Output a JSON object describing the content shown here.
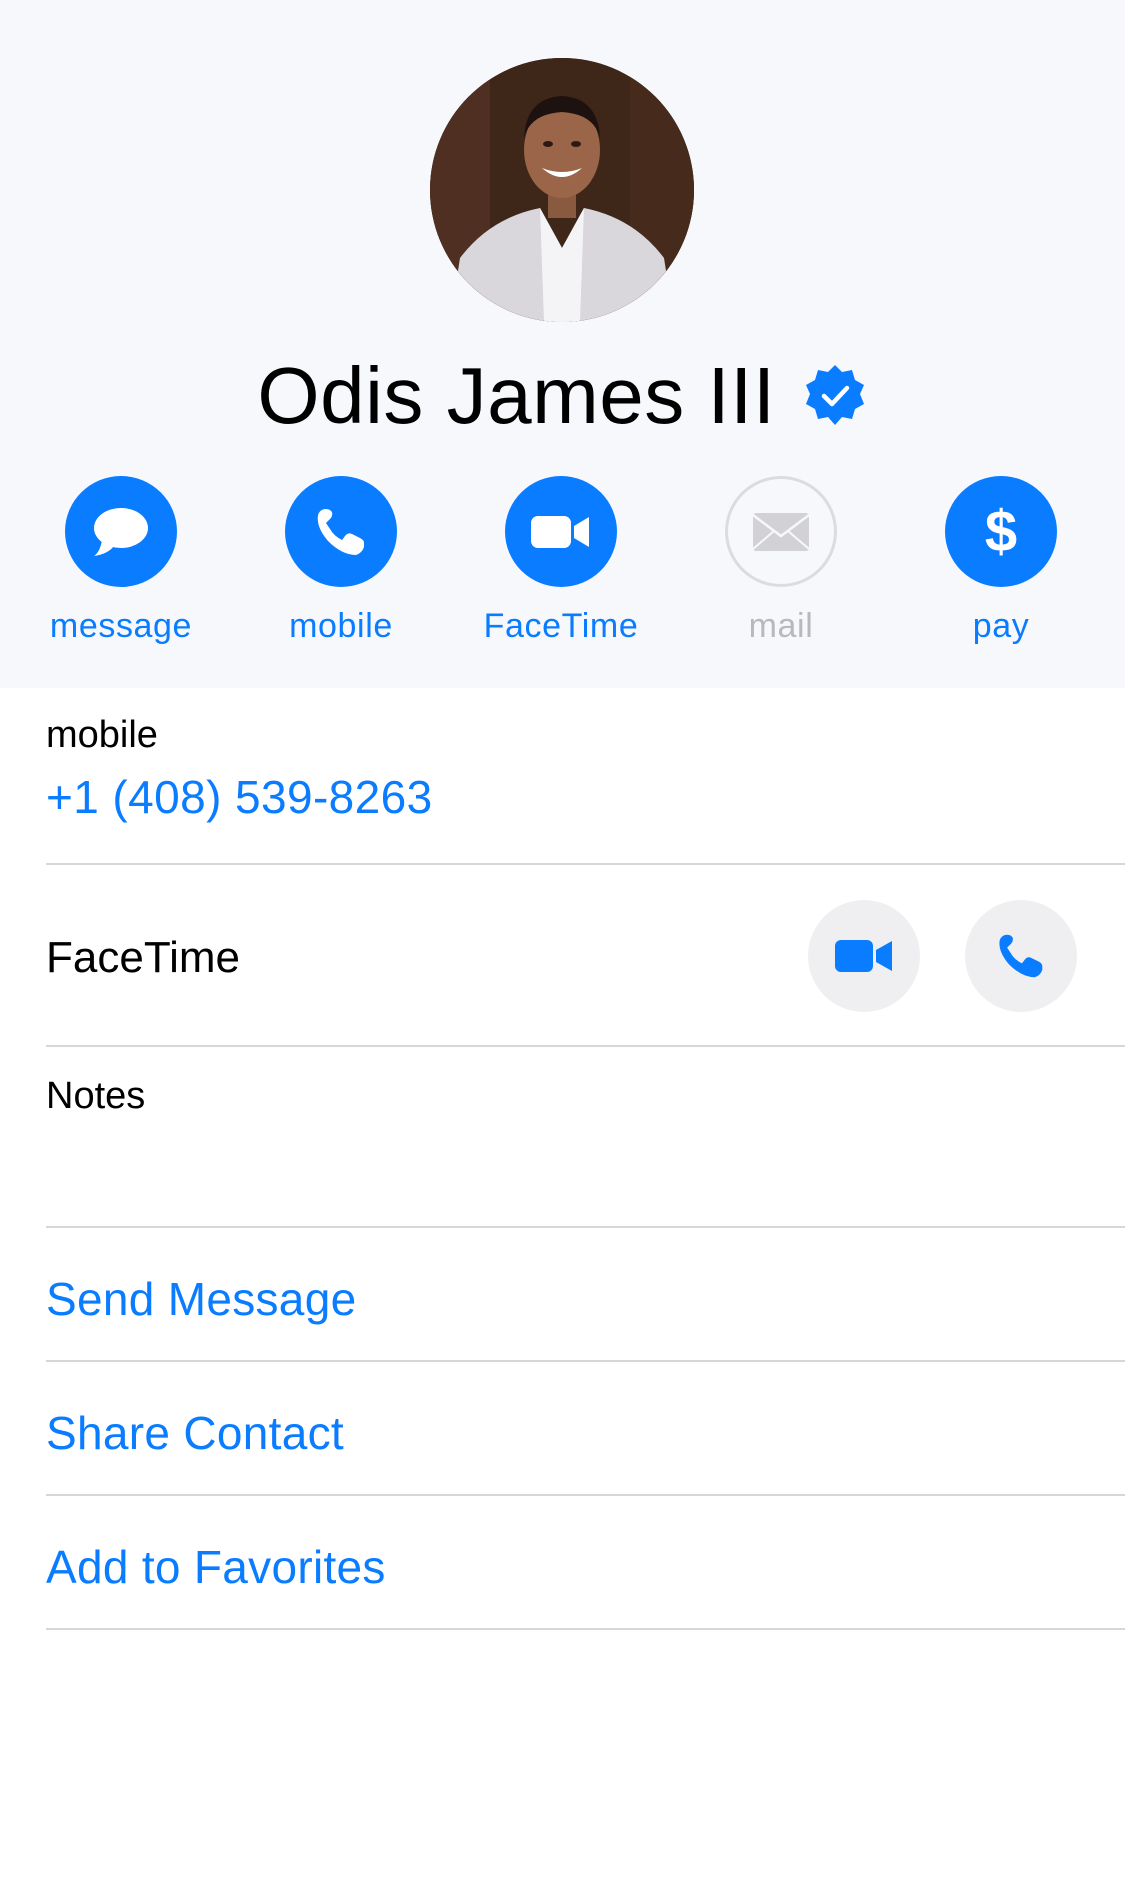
{
  "contact": {
    "name": "Odis James III",
    "verified": true
  },
  "actions": [
    {
      "label": "message",
      "icon": "message-bubble-icon",
      "enabled": true
    },
    {
      "label": "mobile",
      "icon": "phone-icon",
      "enabled": true
    },
    {
      "label": "FaceTime",
      "icon": "video-camera-icon",
      "enabled": true
    },
    {
      "label": "mail",
      "icon": "envelope-icon",
      "enabled": false
    },
    {
      "label": "pay",
      "icon": "dollar-icon",
      "enabled": true
    }
  ],
  "phone": {
    "label": "mobile",
    "number": "+1 (408) 539-8263"
  },
  "facetime": {
    "label": "FaceTime"
  },
  "notes": {
    "label": "Notes",
    "value": ""
  },
  "links": {
    "send_message": "Send Message",
    "share_contact": "Share Contact",
    "add_favorites": "Add to Favorites"
  },
  "colors": {
    "accent": "#0a7cff",
    "header_bg": "#f7f8fc",
    "separator": "#d7d7db",
    "disabled": "#b8b8bd"
  }
}
